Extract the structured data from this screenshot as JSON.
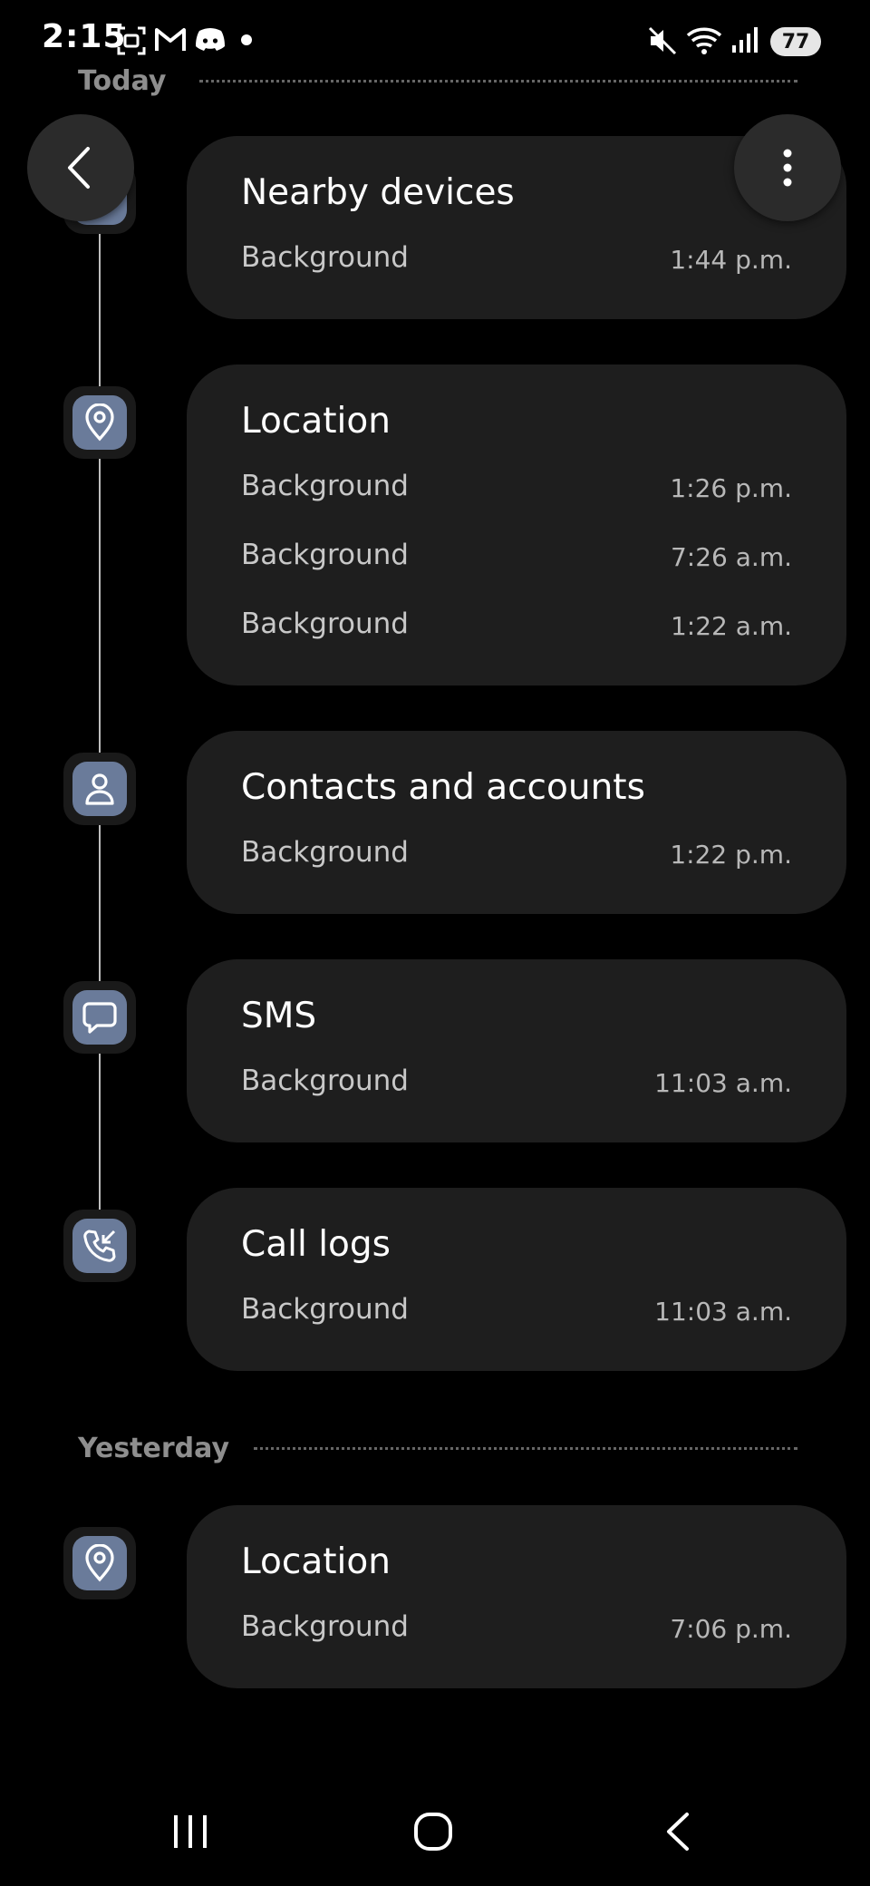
{
  "status_bar": {
    "time": "2:15",
    "left_icons": [
      "screenshot-icon",
      "gmail-icon",
      "discord-icon",
      "notification-dot"
    ],
    "right_icons": [
      "mute-icon",
      "wifi-icon",
      "signal-icon"
    ],
    "battery": "77"
  },
  "sections": [
    {
      "header": "Today",
      "entries": [
        {
          "title": "Nearby devices",
          "icon": "nearby-devices-icon",
          "rows": [
            {
              "label": "Background",
              "time": "1:44 p.m."
            }
          ]
        },
        {
          "title": "Location",
          "icon": "location-pin-icon",
          "rows": [
            {
              "label": "Background",
              "time": "1:26 p.m."
            },
            {
              "label": "Background",
              "time": "7:26 a.m."
            },
            {
              "label": "Background",
              "time": "1:22 a.m."
            }
          ]
        },
        {
          "title": "Contacts and accounts",
          "icon": "contact-person-icon",
          "rows": [
            {
              "label": "Background",
              "time": "1:22 p.m."
            }
          ]
        },
        {
          "title": "SMS",
          "icon": "message-bubble-icon",
          "rows": [
            {
              "label": "Background",
              "time": "11:03 a.m."
            }
          ]
        },
        {
          "title": "Call logs",
          "icon": "call-log-icon",
          "rows": [
            {
              "label": "Background",
              "time": "11:03 a.m."
            }
          ]
        }
      ]
    },
    {
      "header": "Yesterday",
      "entries": [
        {
          "title": "Location",
          "icon": "location-pin-icon",
          "rows": [
            {
              "label": "Background",
              "time": "7:06 p.m."
            }
          ]
        }
      ]
    }
  ],
  "nav": {
    "buttons": [
      "recent-apps",
      "home",
      "back"
    ]
  },
  "colors": {
    "background": "#000000",
    "card": "#1e1e1e",
    "icon_tile": "#6a7b9a",
    "secondary_text": "#c8c8c8"
  }
}
